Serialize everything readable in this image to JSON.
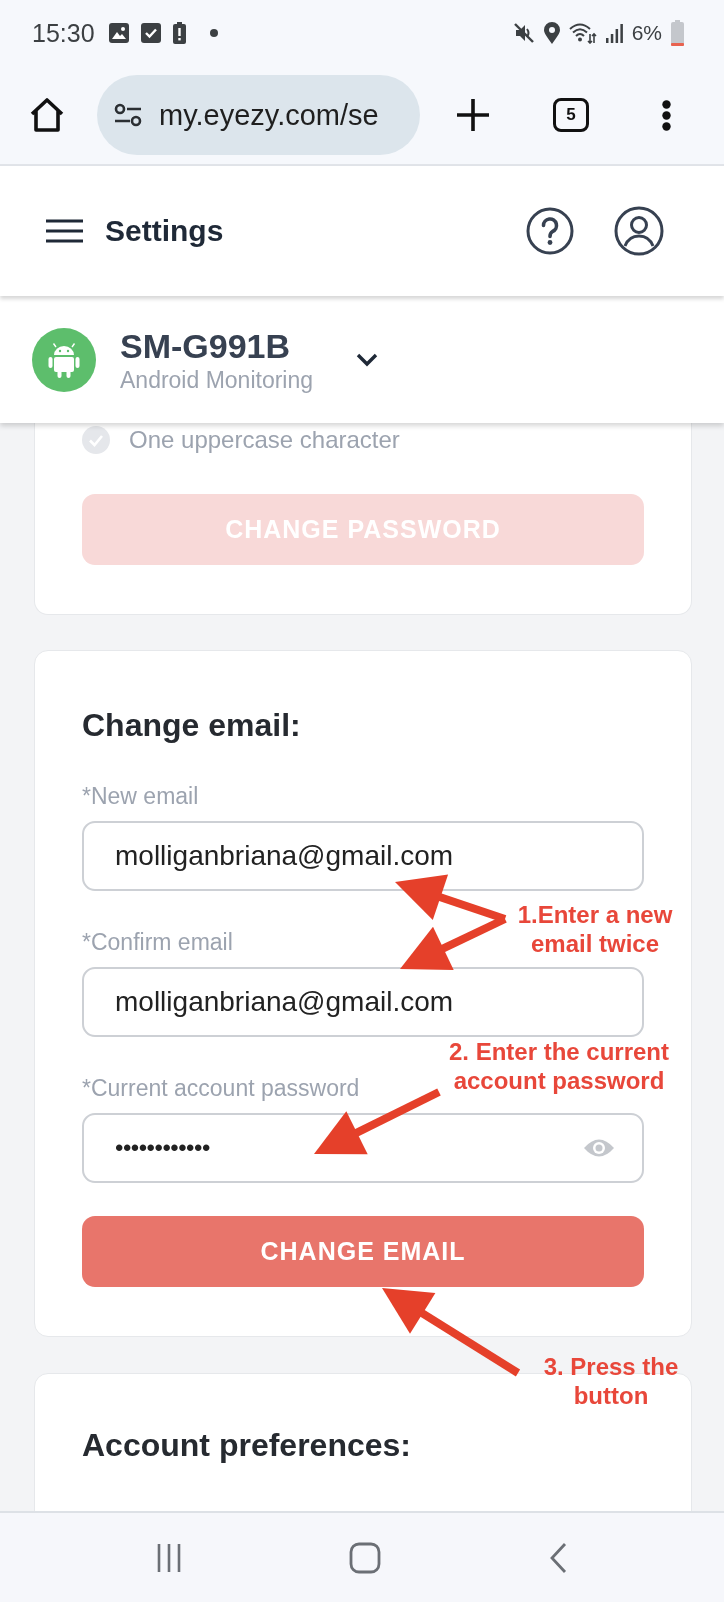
{
  "status_bar": {
    "time": "15:30",
    "battery_percent": "6%"
  },
  "browser": {
    "url": "my.eyezy.com/se",
    "tab_count": "5"
  },
  "app_header": {
    "title": "Settings"
  },
  "device": {
    "name": "SM-G991B",
    "subtitle": "Android Monitoring",
    "expanded": false
  },
  "password_section": {
    "requirements": [
      {
        "label": "One uppercase character",
        "met": false
      }
    ],
    "button": {
      "label": "CHANGE PASSWORD",
      "disabled": true
    }
  },
  "email_section": {
    "title": "Change email:",
    "fields": [
      {
        "kind": "email",
        "label": "*New email",
        "value": "molliganbriana@gmail.com"
      },
      {
        "kind": "email",
        "label": "*Confirm email",
        "value": "molliganbriana@gmail.com"
      },
      {
        "kind": "password",
        "label": "*Current account password",
        "value": "••••••••••••"
      }
    ],
    "button": {
      "label": "CHANGE EMAIL",
      "disabled": false
    }
  },
  "preferences_section": {
    "title": "Account preferences:"
  },
  "annotations": [
    {
      "lines": [
        "1.Enter a new",
        "email twice"
      ]
    },
    {
      "lines": [
        "2. Enter the current",
        "account password"
      ]
    },
    {
      "lines": [
        "3. Press the",
        "button"
      ]
    }
  ]
}
